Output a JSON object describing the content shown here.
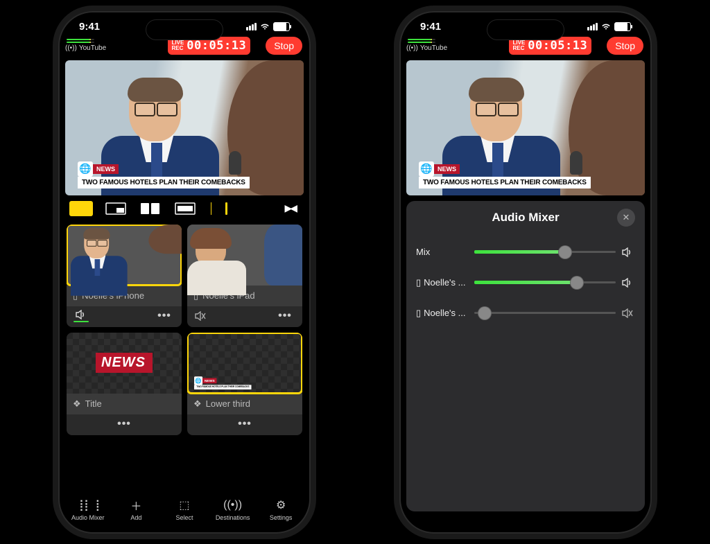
{
  "status": {
    "time": "9:41"
  },
  "stream": {
    "destination": "YouTube",
    "live_label": "LIVE",
    "rec_label": "REC",
    "elapsed": "00:05:13",
    "stop": "Stop"
  },
  "lower_third": {
    "news_tag": "NEWS",
    "headline": "TWO FAMOUS HOTELS PLAN THEIR COMEBACKS"
  },
  "sources": [
    {
      "label": "Noelle's iPhone",
      "icon": "phone",
      "muted": false,
      "selected": true
    },
    {
      "label": "Noelle's iPad",
      "icon": "tablet",
      "muted": true,
      "selected": false
    },
    {
      "label": "Title",
      "icon": "layers",
      "selected": false
    },
    {
      "label": "Lower third",
      "icon": "layers",
      "selected": true
    }
  ],
  "bottom": [
    {
      "label": "Audio Mixer"
    },
    {
      "label": "Add"
    },
    {
      "label": "Select"
    },
    {
      "label": "Destinations"
    },
    {
      "label": "Settings"
    }
  ],
  "mixer": {
    "title": "Audio Mixer",
    "rows": [
      {
        "label": "Mix",
        "level": 0.62,
        "muted": false
      },
      {
        "label": "Noelle's ...",
        "icon": "phone",
        "level": 0.7,
        "muted": false
      },
      {
        "label": "Noelle's ...",
        "icon": "tablet",
        "level": 0.05,
        "muted": true
      }
    ]
  },
  "news_graphic": "NEWS"
}
